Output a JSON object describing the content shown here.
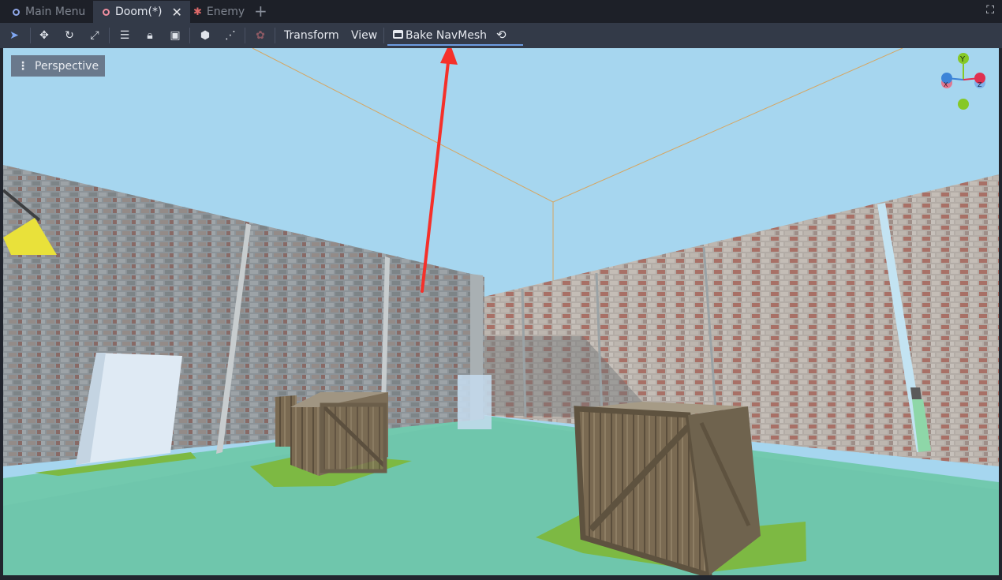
{
  "tabs": [
    {
      "label": "Main Menu",
      "state": "inactive"
    },
    {
      "label": "Doom(*)",
      "state": "active"
    },
    {
      "label": "Enemy",
      "state": "inactive"
    }
  ],
  "icons": {
    "new_tab": "+",
    "fullscreen": "⛶",
    "tab_close": "✕"
  },
  "toolbar": {
    "transform_label": "Transform",
    "view_label": "View",
    "bake_label": "Bake NavMesh"
  },
  "viewport": {
    "perspective_label": "Perspective",
    "gizmo_axes": [
      "Y",
      "X",
      "Z"
    ]
  },
  "colors": {
    "sky": "#a6d6ef",
    "floor": "#6fc9ad",
    "navmesh": "#7db943",
    "annotation_arrow": "#f5302a",
    "axis_x": "#e03050",
    "axis_y": "#86c826",
    "axis_z": "#3c84d8"
  }
}
